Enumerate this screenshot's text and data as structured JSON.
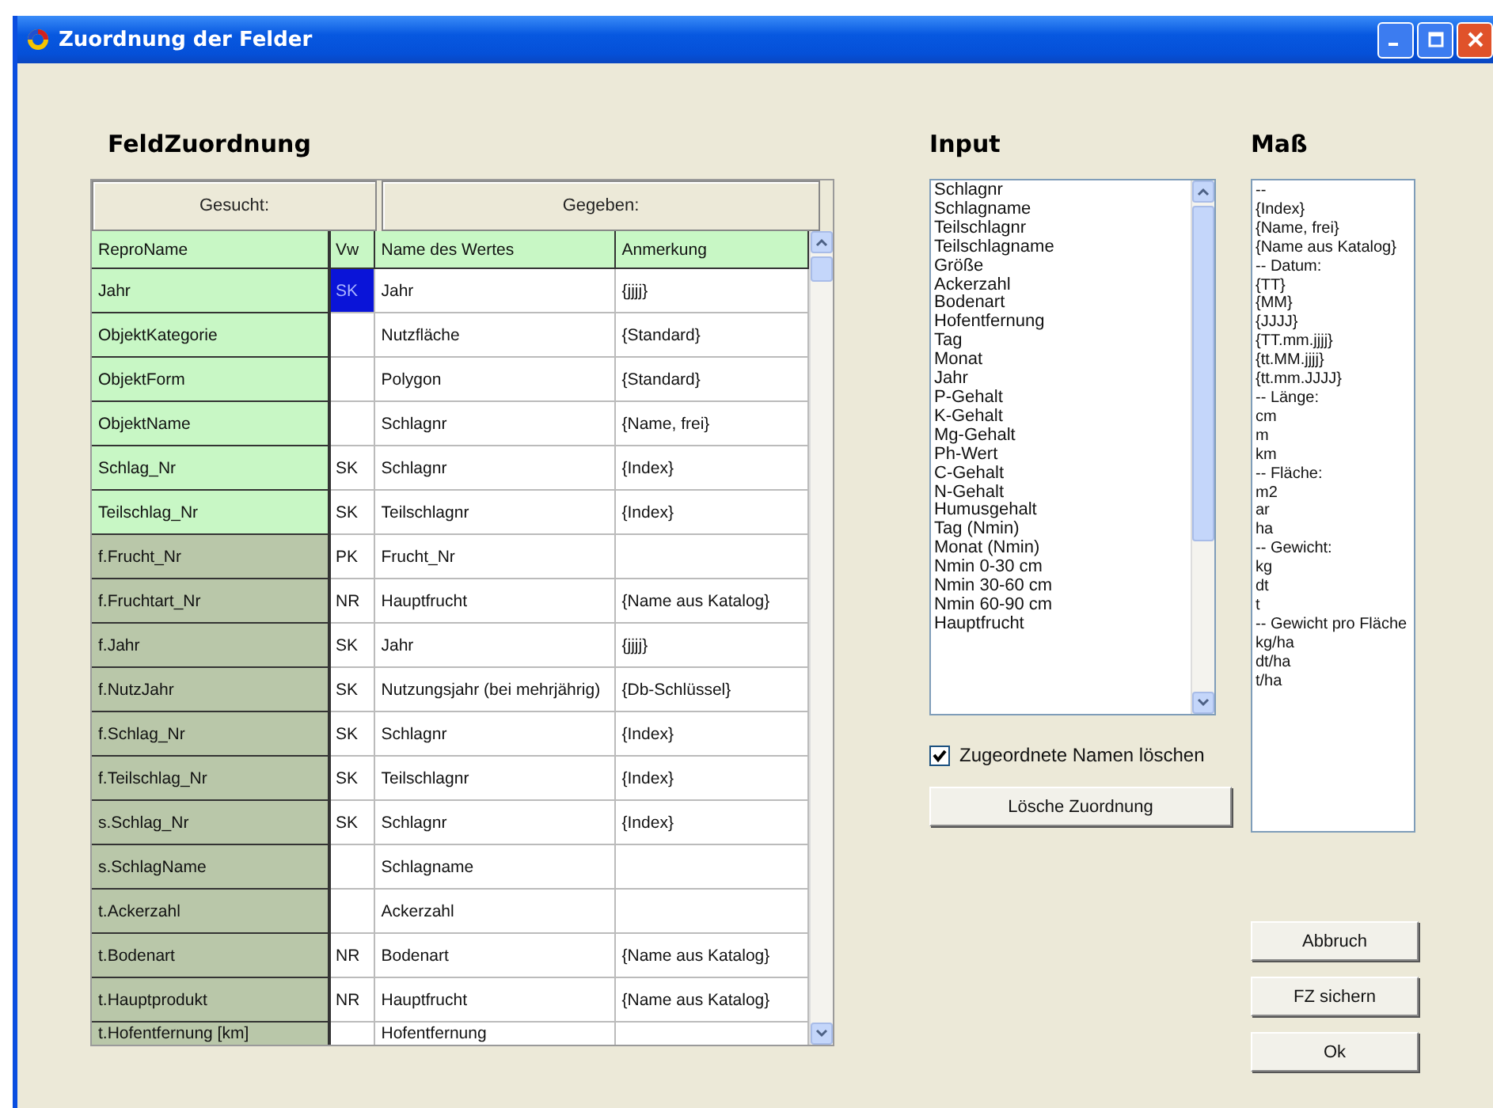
{
  "window": {
    "title": "Zuordnung der Felder"
  },
  "mapping": {
    "heading": "FeldZuordnung",
    "group_headers": [
      "Gesucht:",
      "Gegeben:"
    ],
    "columns": [
      "ReproName",
      "Vw",
      "Name des Wertes",
      "Anmerkung"
    ],
    "rows": [
      {
        "repro": "Jahr",
        "vw": "SK",
        "name": "Jahr",
        "note": "{jjjj}",
        "color": "#c8f7c5",
        "selected": true
      },
      {
        "repro": "ObjektKategorie",
        "vw": "",
        "name": "Nutzfläche",
        "note": "{Standard}",
        "color": "#c8f7c5",
        "selected": false
      },
      {
        "repro": "ObjektForm",
        "vw": "",
        "name": "Polygon",
        "note": "{Standard}",
        "color": "#c8f7c5",
        "selected": false
      },
      {
        "repro": "ObjektName",
        "vw": "",
        "name": "Schlagnr",
        "note": "{Name, frei}",
        "color": "#c8f7c5",
        "selected": false
      },
      {
        "repro": "Schlag_Nr",
        "vw": "SK",
        "name": "Schlagnr",
        "note": "{Index}",
        "color": "#c8f7c5",
        "selected": false
      },
      {
        "repro": "Teilschlag_Nr",
        "vw": "SK",
        "name": "Teilschlagnr",
        "note": "{Index}",
        "color": "#c8f7c5",
        "selected": false
      },
      {
        "repro": "f.Frucht_Nr",
        "vw": "PK",
        "name": "Frucht_Nr",
        "note": "",
        "color": "#b9c7a9",
        "selected": false
      },
      {
        "repro": "f.Fruchtart_Nr",
        "vw": "NR",
        "name": "Hauptfrucht",
        "note": "{Name aus Katalog}",
        "color": "#b9c7a9",
        "selected": false
      },
      {
        "repro": "f.Jahr",
        "vw": "SK",
        "name": "Jahr",
        "note": "{jjjj}",
        "color": "#b9c7a9",
        "selected": false
      },
      {
        "repro": "f.NutzJahr",
        "vw": "SK",
        "name": "Nutzungsjahr (bei mehrjährig)",
        "note": "{Db-Schlüssel}",
        "color": "#b9c7a9",
        "selected": false
      },
      {
        "repro": "f.Schlag_Nr",
        "vw": "SK",
        "name": "Schlagnr",
        "note": "{Index}",
        "color": "#b9c7a9",
        "selected": false
      },
      {
        "repro": "f.Teilschlag_Nr",
        "vw": "SK",
        "name": "Teilschlagnr",
        "note": "{Index}",
        "color": "#b9c7a9",
        "selected": false
      },
      {
        "repro": "s.Schlag_Nr",
        "vw": "SK",
        "name": "Schlagnr",
        "note": "{Index}",
        "color": "#b9c7a9",
        "selected": false
      },
      {
        "repro": "s.SchlagName",
        "vw": "",
        "name": "Schlagname",
        "note": "",
        "color": "#b9c7a9",
        "selected": false
      },
      {
        "repro": "t.Ackerzahl",
        "vw": "",
        "name": "Ackerzahl",
        "note": "",
        "color": "#b9c7a9",
        "selected": false
      },
      {
        "repro": "t.Bodenart",
        "vw": "NR",
        "name": "Bodenart",
        "note": "{Name aus Katalog}",
        "color": "#b9c7a9",
        "selected": false
      },
      {
        "repro": "t.Hauptprodukt",
        "vw": "NR",
        "name": "Hauptfrucht",
        "note": "{Name aus Katalog}",
        "color": "#b9c7a9",
        "selected": false
      },
      {
        "repro": "t.Hofentfernung [km]",
        "vw": "",
        "name": "Hofentfernung",
        "note": "",
        "color": "#b9c7a9",
        "selected": false
      }
    ]
  },
  "input": {
    "heading": "Input",
    "items": [
      "Schlagnr",
      "Schlagname",
      "Teilschlagnr",
      "Teilschlagname",
      "Größe",
      "Ackerzahl",
      "Bodenart",
      "Hofentfernung",
      "Tag",
      "Monat",
      "Jahr",
      "P-Gehalt",
      "K-Gehalt",
      "Mg-Gehalt",
      "Ph-Wert",
      "C-Gehalt",
      "N-Gehalt",
      "Humusgehalt",
      "Tag (Nmin)",
      "Monat (Nmin)",
      "Nmin 0-30 cm",
      "Nmin 30-60 cm",
      "Nmin 60-90 cm",
      "Hauptfrucht"
    ],
    "checkbox": {
      "label": "Zugeordnete Namen löschen",
      "checked": true
    },
    "button": "Lösche Zuordnung"
  },
  "mass": {
    "heading": "Maß",
    "items": [
      "--",
      "{Index}",
      "{Name, frei}",
      "{Name aus Katalog}",
      "-- Datum:",
      "{TT}",
      "{MM}",
      "{JJJJ}",
      "{TT.mm.jjjj}",
      "{tt.MM.jjjj}",
      "{tt.mm.JJJJ}",
      "-- Länge:",
      "cm",
      "m",
      "km",
      "-- Fläche:",
      "m2",
      "ar",
      "ha",
      "-- Gewicht:",
      "kg",
      "dt",
      "t",
      "-- Gewicht pro Fläche",
      "kg/ha",
      "dt/ha",
      "t/ha"
    ]
  },
  "buttons": [
    "Abbruch",
    "FZ sichern",
    "Ok"
  ]
}
